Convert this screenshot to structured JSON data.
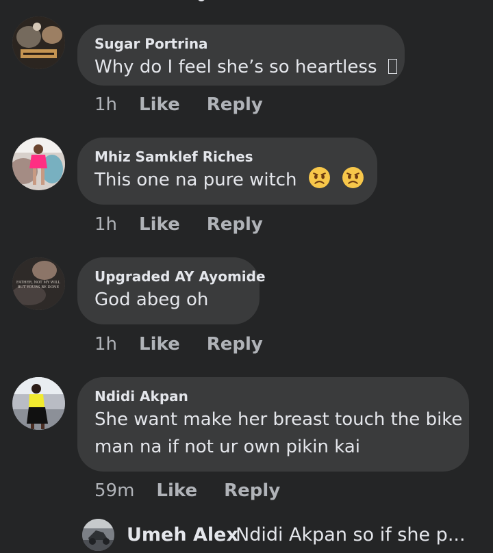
{
  "comments": [
    {
      "name": "Sugar Portrina",
      "text_line1": "Why do I feel she’s so heartless",
      "time": "1h",
      "like": "Like",
      "reply": "Reply"
    },
    {
      "name": "Mhiz Samklef Riches",
      "text_line1": "This one na pure witch",
      "time": "1h",
      "like": "Like",
      "reply": "Reply",
      "emojis": [
        "pouting-face-icon",
        "pouting-face-icon"
      ]
    },
    {
      "name": "Upgraded AY Ayomide",
      "text_line1": "God abeg oh",
      "avatar_caption_1": "FATHER, NOT MY WILL",
      "avatar_caption_2": "BUT YOURS BE DONE",
      "time": "1h",
      "like": "Like",
      "reply": "Reply"
    },
    {
      "name": "Ndidi Akpan",
      "text_line1": "She want make her breast touch the bike",
      "text_line2": "man na if not ur own pikin kai",
      "time": "59m",
      "like": "Like",
      "reply": "Reply"
    }
  ],
  "reply_preview": {
    "name": "Umeh Alex",
    "text": "Ndidi Akpan so if she p..."
  },
  "colors": {
    "background": "#242526",
    "bubble": "#3a3b3c",
    "primary_text": "#e4e6eb",
    "secondary_text": "#b0b3b8"
  }
}
